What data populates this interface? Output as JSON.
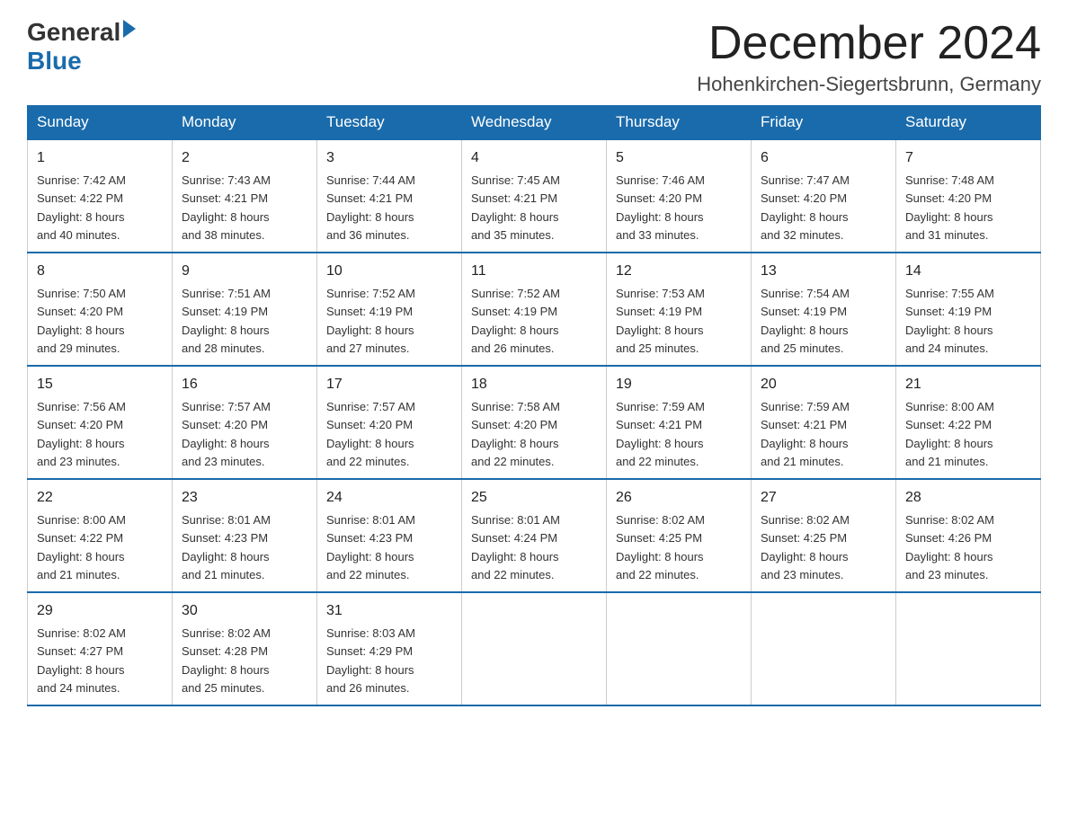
{
  "logo": {
    "general": "General",
    "blue": "Blue",
    "tagline": "Blue"
  },
  "header": {
    "month_title": "December 2024",
    "location": "Hohenkirchen-Siegertsbrunn, Germany"
  },
  "weekdays": [
    "Sunday",
    "Monday",
    "Tuesday",
    "Wednesday",
    "Thursday",
    "Friday",
    "Saturday"
  ],
  "weeks": [
    [
      {
        "day": "1",
        "sunrise": "7:42 AM",
        "sunset": "4:22 PM",
        "daylight": "8 hours and 40 minutes."
      },
      {
        "day": "2",
        "sunrise": "7:43 AM",
        "sunset": "4:21 PM",
        "daylight": "8 hours and 38 minutes."
      },
      {
        "day": "3",
        "sunrise": "7:44 AM",
        "sunset": "4:21 PM",
        "daylight": "8 hours and 36 minutes."
      },
      {
        "day": "4",
        "sunrise": "7:45 AM",
        "sunset": "4:21 PM",
        "daylight": "8 hours and 35 minutes."
      },
      {
        "day": "5",
        "sunrise": "7:46 AM",
        "sunset": "4:20 PM",
        "daylight": "8 hours and 33 minutes."
      },
      {
        "day": "6",
        "sunrise": "7:47 AM",
        "sunset": "4:20 PM",
        "daylight": "8 hours and 32 minutes."
      },
      {
        "day": "7",
        "sunrise": "7:48 AM",
        "sunset": "4:20 PM",
        "daylight": "8 hours and 31 minutes."
      }
    ],
    [
      {
        "day": "8",
        "sunrise": "7:50 AM",
        "sunset": "4:20 PM",
        "daylight": "8 hours and 29 minutes."
      },
      {
        "day": "9",
        "sunrise": "7:51 AM",
        "sunset": "4:19 PM",
        "daylight": "8 hours and 28 minutes."
      },
      {
        "day": "10",
        "sunrise": "7:52 AM",
        "sunset": "4:19 PM",
        "daylight": "8 hours and 27 minutes."
      },
      {
        "day": "11",
        "sunrise": "7:52 AM",
        "sunset": "4:19 PM",
        "daylight": "8 hours and 26 minutes."
      },
      {
        "day": "12",
        "sunrise": "7:53 AM",
        "sunset": "4:19 PM",
        "daylight": "8 hours and 25 minutes."
      },
      {
        "day": "13",
        "sunrise": "7:54 AM",
        "sunset": "4:19 PM",
        "daylight": "8 hours and 25 minutes."
      },
      {
        "day": "14",
        "sunrise": "7:55 AM",
        "sunset": "4:19 PM",
        "daylight": "8 hours and 24 minutes."
      }
    ],
    [
      {
        "day": "15",
        "sunrise": "7:56 AM",
        "sunset": "4:20 PM",
        "daylight": "8 hours and 23 minutes."
      },
      {
        "day": "16",
        "sunrise": "7:57 AM",
        "sunset": "4:20 PM",
        "daylight": "8 hours and 23 minutes."
      },
      {
        "day": "17",
        "sunrise": "7:57 AM",
        "sunset": "4:20 PM",
        "daylight": "8 hours and 22 minutes."
      },
      {
        "day": "18",
        "sunrise": "7:58 AM",
        "sunset": "4:20 PM",
        "daylight": "8 hours and 22 minutes."
      },
      {
        "day": "19",
        "sunrise": "7:59 AM",
        "sunset": "4:21 PM",
        "daylight": "8 hours and 22 minutes."
      },
      {
        "day": "20",
        "sunrise": "7:59 AM",
        "sunset": "4:21 PM",
        "daylight": "8 hours and 21 minutes."
      },
      {
        "day": "21",
        "sunrise": "8:00 AM",
        "sunset": "4:22 PM",
        "daylight": "8 hours and 21 minutes."
      }
    ],
    [
      {
        "day": "22",
        "sunrise": "8:00 AM",
        "sunset": "4:22 PM",
        "daylight": "8 hours and 21 minutes."
      },
      {
        "day": "23",
        "sunrise": "8:01 AM",
        "sunset": "4:23 PM",
        "daylight": "8 hours and 21 minutes."
      },
      {
        "day": "24",
        "sunrise": "8:01 AM",
        "sunset": "4:23 PM",
        "daylight": "8 hours and 22 minutes."
      },
      {
        "day": "25",
        "sunrise": "8:01 AM",
        "sunset": "4:24 PM",
        "daylight": "8 hours and 22 minutes."
      },
      {
        "day": "26",
        "sunrise": "8:02 AM",
        "sunset": "4:25 PM",
        "daylight": "8 hours and 22 minutes."
      },
      {
        "day": "27",
        "sunrise": "8:02 AM",
        "sunset": "4:25 PM",
        "daylight": "8 hours and 23 minutes."
      },
      {
        "day": "28",
        "sunrise": "8:02 AM",
        "sunset": "4:26 PM",
        "daylight": "8 hours and 23 minutes."
      }
    ],
    [
      {
        "day": "29",
        "sunrise": "8:02 AM",
        "sunset": "4:27 PM",
        "daylight": "8 hours and 24 minutes."
      },
      {
        "day": "30",
        "sunrise": "8:02 AM",
        "sunset": "4:28 PM",
        "daylight": "8 hours and 25 minutes."
      },
      {
        "day": "31",
        "sunrise": "8:03 AM",
        "sunset": "4:29 PM",
        "daylight": "8 hours and 26 minutes."
      },
      null,
      null,
      null,
      null
    ]
  ],
  "labels": {
    "sunrise": "Sunrise:",
    "sunset": "Sunset:",
    "daylight": "Daylight:"
  }
}
